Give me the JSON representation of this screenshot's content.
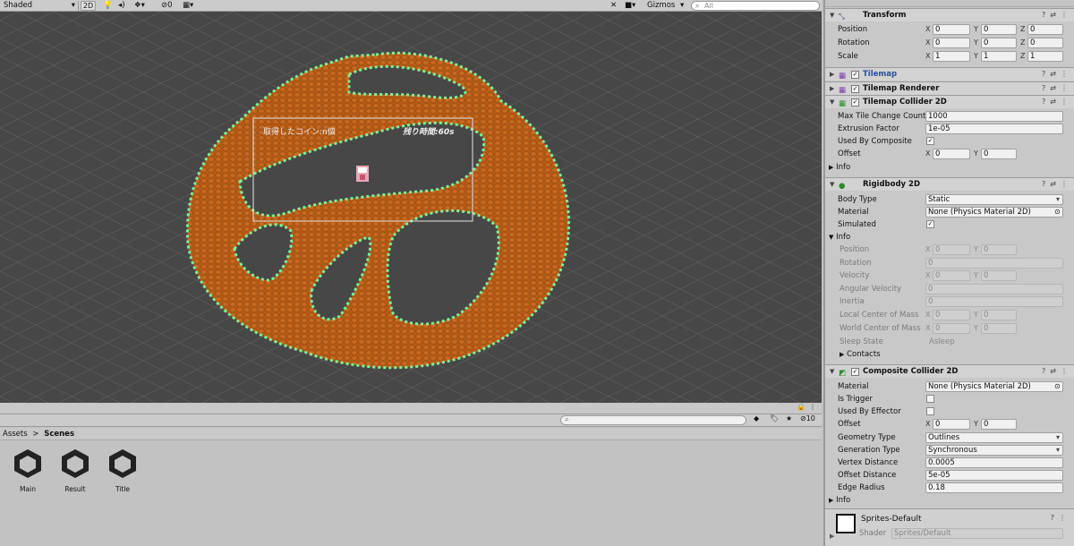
{
  "scene_toolbar": {
    "shading_mode": "Shaded",
    "mode_2d": "2D",
    "hidden_count": "0",
    "gizmos": "Gizmos",
    "search_placeholder": "All"
  },
  "scene": {
    "ui_coins_text": "取得したコイン:n個",
    "ui_time_text": "残り時間:60s"
  },
  "project": {
    "hidden_count": "10",
    "breadcrumb_root": "Assets",
    "breadcrumb_sep": ">",
    "breadcrumb_current": "Scenes",
    "assets": [
      {
        "name": "Main"
      },
      {
        "name": "Result"
      },
      {
        "name": "Title"
      }
    ]
  },
  "inspector": {
    "transform": {
      "title": "Transform",
      "position_label": "Position",
      "rotation_label": "Rotation",
      "scale_label": "Scale",
      "position": [
        "0",
        "0",
        "0"
      ],
      "rotation": [
        "0",
        "0",
        "0"
      ],
      "scale": [
        "1",
        "1",
        "1"
      ]
    },
    "tilemap": {
      "title": "Tilemap"
    },
    "tilemap_renderer": {
      "title": "Tilemap Renderer"
    },
    "tilemap_collider": {
      "title": "Tilemap Collider 2D",
      "max_tile_label": "Max Tile Change Count",
      "max_tile_value": "1000",
      "extrusion_label": "Extrusion Factor",
      "extrusion_value": "1e-05",
      "used_by_composite_label": "Used By Composite",
      "offset_label": "Offset",
      "offset": [
        "0",
        "0"
      ],
      "info_label": "Info"
    },
    "rigidbody": {
      "title": "Rigidbody 2D",
      "body_type_label": "Body Type",
      "body_type_value": "Static",
      "material_label": "Material",
      "material_value": "None (Physics Material 2D)",
      "simulated_label": "Simulated",
      "info_label": "Info",
      "position_label": "Position",
      "position": [
        "0",
        "0"
      ],
      "rotation_label": "Rotation",
      "rotation_value": "0",
      "velocity_label": "Velocity",
      "velocity": [
        "0",
        "0"
      ],
      "angular_velocity_label": "Angular Velocity",
      "angular_velocity_value": "0",
      "inertia_label": "Inertia",
      "inertia_value": "0",
      "local_com_label": "Local Center of Mass",
      "local_com": [
        "0",
        "0"
      ],
      "world_com_label": "World Center of Mass",
      "world_com": [
        "0",
        "0"
      ],
      "sleep_state_label": "Sleep State",
      "sleep_state_value": "Asleep",
      "contacts_label": "Contacts"
    },
    "composite": {
      "title": "Composite Collider 2D",
      "material_label": "Material",
      "material_value": "None (Physics Material 2D)",
      "is_trigger_label": "Is Trigger",
      "used_by_effector_label": "Used By Effector",
      "offset_label": "Offset",
      "offset": [
        "0",
        "0"
      ],
      "geometry_type_label": "Geometry Type",
      "geometry_type_value": "Outlines",
      "generation_type_label": "Generation Type",
      "generation_type_value": "Synchronous",
      "vertex_distance_label": "Vertex Distance",
      "vertex_distance_value": "0.0005",
      "offset_distance_label": "Offset Distance",
      "offset_distance_value": "5e-05",
      "edge_radius_label": "Edge Radius",
      "edge_radius_value": "0.18",
      "info_label": "Info"
    },
    "material": {
      "name": "Sprites-Default",
      "shader_label": "Shader",
      "shader_value": "Sprites/Default"
    },
    "axis": {
      "x": "X",
      "y": "Y",
      "z": "Z"
    }
  }
}
